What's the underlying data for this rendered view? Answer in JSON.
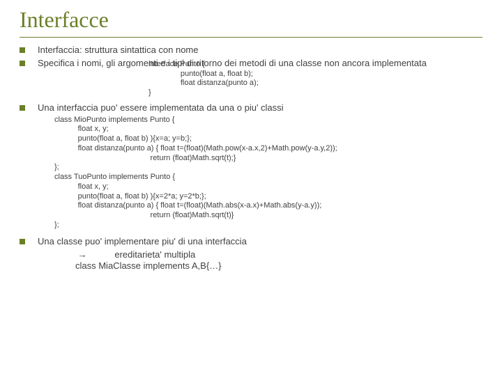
{
  "title": "Interfacce",
  "bullets": {
    "b1": "Interfaccia: struttura sintattica con nome",
    "b2": "Specifica i nomi, gli argomenti e i tipi di ritorno dei metodi di una classe non ancora implementata",
    "b3": "Una interfaccia puo' essere implementata da una o piu' classi",
    "b4": "Una classe puo' implementare piu' di una interfaccia"
  },
  "code": {
    "interface": "interface Punto {\n               punto(float a, float b);\n               float distanza(punto a);\n}",
    "classes": "class MioPunto implements Punto {\n           float x, y;\n           punto(float a, float b) ){x=a; y=b;};\n           float distanza(punto a) { float t=(float)(Math.pow(x-a.x,2)+Math.pow(y-a.y,2));\n                                             return (float)Math.sqrt(t);}\n};\nclass TuoPunto implements Punto {\n           float x, y;\n           punto(float a, float b) ){x=2*a; y=2*b;};\n           float distanza(punto a) { float t=(float)(Math.abs(x-a.x)+Math.abs(y-a.y));\n                                             return (float)Math.sqrt(t)}\n};",
    "multi": " →           ereditarieta' multipla\nclass MiaClasse implements A,B{…}"
  }
}
